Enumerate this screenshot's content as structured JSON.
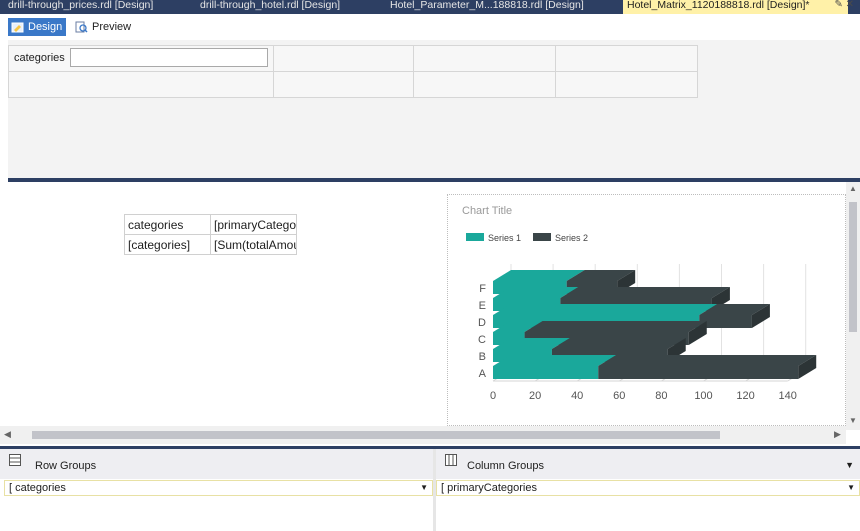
{
  "tabs": [
    {
      "label": "drill-through_prices.rdl [Design]",
      "active": false
    },
    {
      "label": "drill-through_hotel.rdl [Design]",
      "active": false
    },
    {
      "label": "Hotel_Parameter_M...188818.rdl [Design]",
      "active": false
    },
    {
      "label": "Hotel_Matrix_1120188818.rdl [Design]*",
      "active": true
    }
  ],
  "tab_actions": "✎ ✕",
  "viewbar": {
    "design_label": "Design",
    "preview_label": "Preview"
  },
  "parameters": {
    "label": "categories",
    "value": ""
  },
  "tablix": {
    "rows": [
      [
        "categories",
        "[primaryCatego"
      ],
      [
        "[categories]",
        "[Sum(totalAmou"
      ]
    ]
  },
  "colors": {
    "series1": "#1aa89b",
    "series2": "#3a4548",
    "accent": "#2d3f63"
  },
  "chart_data": {
    "type": "bar",
    "orientation": "horizontal",
    "stacked": true,
    "three_d": true,
    "title": "Chart Title",
    "categories": [
      "A",
      "B",
      "C",
      "D",
      "E",
      "F"
    ],
    "series": [
      {
        "name": "Series 1",
        "values": [
          50,
          28,
          15,
          98,
          32,
          35
        ]
      },
      {
        "name": "Series 2",
        "values": [
          95,
          55,
          78,
          25,
          72,
          24
        ]
      }
    ],
    "xlim": [
      0,
      140
    ],
    "xticks": [
      0,
      20,
      40,
      60,
      80,
      100,
      120,
      140
    ],
    "grid": true,
    "legend": "top-left"
  },
  "groups": {
    "row_title": "Row Groups",
    "column_title": "Column Groups",
    "row_item": "categories",
    "column_item": "primaryCategories"
  }
}
